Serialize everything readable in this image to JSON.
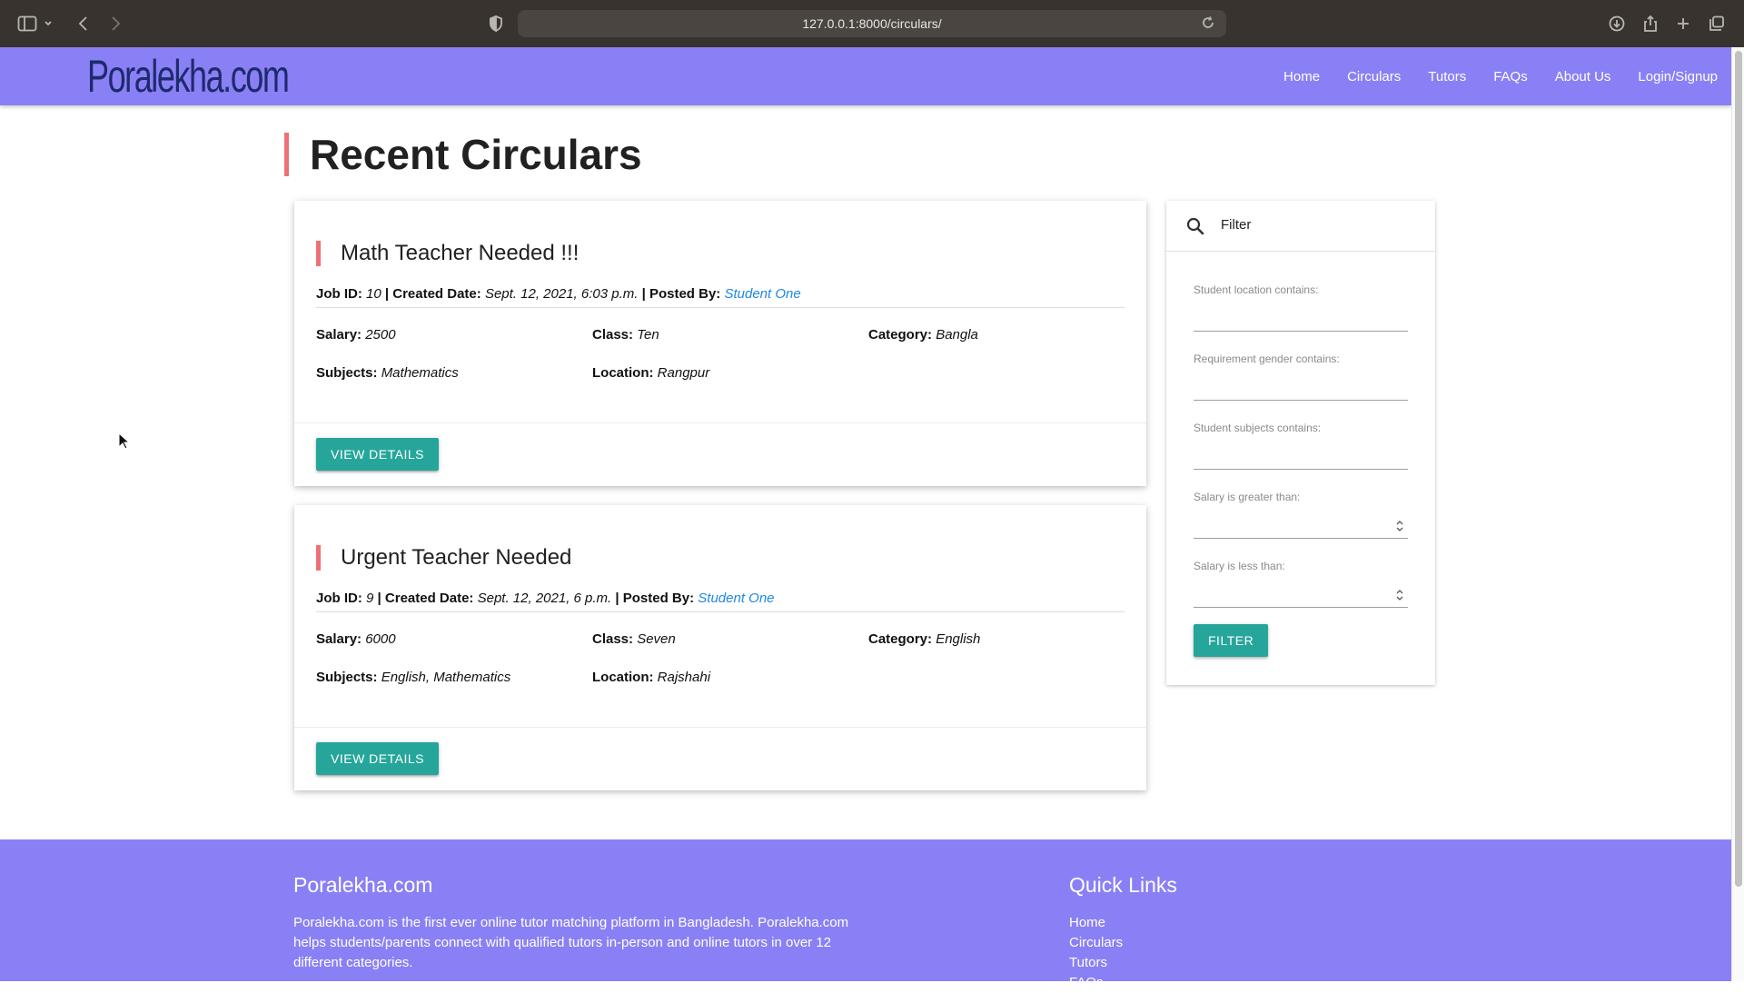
{
  "browser": {
    "url": "127.0.0.1:8000/circulars/",
    "icons": [
      "sidebar-icon",
      "chevron-down-icon",
      "back-icon",
      "forward-icon",
      "shield-icon",
      "reload-icon",
      "download-icon",
      "share-icon",
      "new-tab-icon",
      "tabs-icon"
    ]
  },
  "navbar": {
    "logo": "Poralekha.com",
    "links": [
      "Home",
      "Circulars",
      "Tutors",
      "FAQs",
      "About Us",
      "Login/Signup"
    ]
  },
  "page": {
    "title": "Recent Circulars"
  },
  "circulars": [
    {
      "title": "Math Teacher Needed !!!",
      "job_id_label": "Job ID:",
      "job_id": "10",
      "created_label": "| Created Date:",
      "created": "Sept. 12, 2021, 6:03 p.m.",
      "posted_label": "| Posted By:",
      "posted_by": "Student One",
      "salary_label": "Salary:",
      "salary": "2500",
      "class_label": "Class:",
      "class": "Ten",
      "category_label": "Category:",
      "category": "Bangla",
      "subjects_label": "Subjects:",
      "subjects": "Mathematics",
      "location_label": "Location:",
      "location": "Rangpur",
      "button": "VIEW DETAILS"
    },
    {
      "title": "Urgent Teacher Needed",
      "job_id_label": "Job ID:",
      "job_id": "9",
      "created_label": "| Created Date:",
      "created": "Sept. 12, 2021, 6 p.m.",
      "posted_label": "| Posted By:",
      "posted_by": "Student One",
      "salary_label": "Salary:",
      "salary": "6000",
      "class_label": "Class:",
      "class": "Seven",
      "category_label": "Category:",
      "category": "English",
      "subjects_label": "Subjects:",
      "subjects": "English, Mathematics",
      "location_label": "Location:",
      "location": "Rajshahi",
      "button": "VIEW DETAILS"
    }
  ],
  "filter": {
    "title": "Filter",
    "fields": [
      {
        "label": "Student location contains:",
        "value": ""
      },
      {
        "label": "Requirement gender contains:",
        "value": ""
      },
      {
        "label": "Student subjects contains:",
        "value": ""
      },
      {
        "label": "Salary is greater than:",
        "value": ""
      },
      {
        "label": "Salary is less than:",
        "value": ""
      }
    ],
    "button": "FILTER"
  },
  "footer": {
    "brand": "Poralekha.com",
    "description": "Poralekha.com is the first ever online tutor matching platform in Bangladesh. Poralekha.com helps students/parents connect with qualified tutors in-person and online tutors in over 12 different categories.",
    "quick_links_title": "Quick Links",
    "quick_links": [
      "Home",
      "Circulars",
      "Tutors",
      "FAQs"
    ]
  },
  "colors": {
    "navbar": "#8a80f5",
    "accent_bar": "#ef6f78",
    "button": "#26a69a",
    "link": "#1e88e5"
  }
}
